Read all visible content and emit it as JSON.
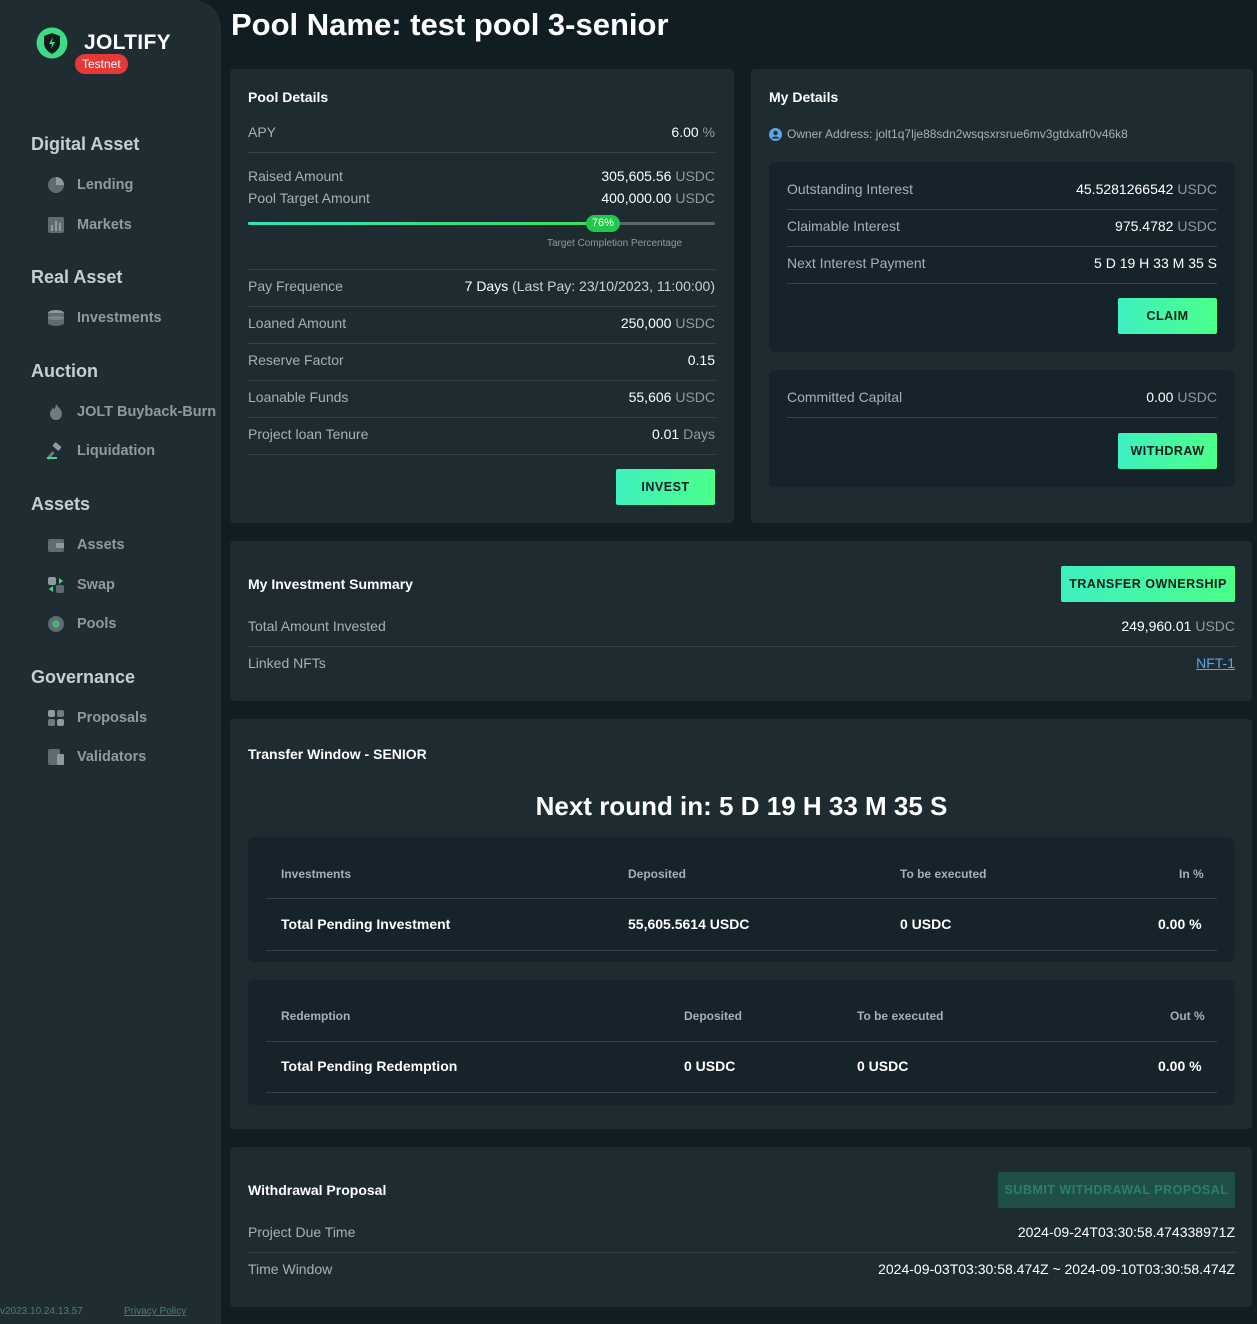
{
  "sidebar": {
    "brand": "JOLTIFY",
    "badge": "Testnet",
    "sections": [
      {
        "title": "Digital Asset",
        "items": [
          {
            "label": "Lending",
            "icon": "lending-icon"
          },
          {
            "label": "Markets",
            "icon": "markets-icon"
          }
        ]
      },
      {
        "title": "Real Asset",
        "items": [
          {
            "label": "Investments",
            "icon": "investments-icon"
          }
        ]
      },
      {
        "title": "Auction",
        "items": [
          {
            "label": "JOLT Buyback-Burn",
            "icon": "fire-icon"
          },
          {
            "label": "Liquidation",
            "icon": "gavel-icon"
          }
        ]
      },
      {
        "title": "Assets",
        "items": [
          {
            "label": "Assets",
            "icon": "wallet-icon"
          },
          {
            "label": "Swap",
            "icon": "swap-icon"
          },
          {
            "label": "Pools",
            "icon": "pools-icon"
          }
        ]
      },
      {
        "title": "Governance",
        "items": [
          {
            "label": "Proposals",
            "icon": "proposals-icon"
          },
          {
            "label": "Validators",
            "icon": "validators-icon"
          }
        ]
      }
    ],
    "version": "v2023.10.24.13.57",
    "privacy": "Privacy Policy"
  },
  "page": {
    "title": "Pool Name: test pool 3-senior"
  },
  "pool_details": {
    "title": "Pool Details",
    "apy_label": "APY",
    "apy_value": "6.00",
    "apy_unit": "%",
    "raised_label": "Raised Amount",
    "raised_value": "305,605.56",
    "raised_unit": "USDC",
    "target_label": "Pool Target Amount",
    "target_value": "400,000.00",
    "target_unit": "USDC",
    "progress_percent": 76,
    "progress_badge": "76%",
    "progress_caption": "Target Completion Percentage",
    "pay_freq_label": "Pay Frequence",
    "pay_freq_value": "7 Days",
    "pay_freq_note": "(Last Pay: 23/10/2023, 11:00:00)",
    "loaned_label": "Loaned Amount",
    "loaned_value": "250,000",
    "loaned_unit": "USDC",
    "reserve_label": "Reserve Factor",
    "reserve_value": "0.15",
    "loanable_label": "Loanable Funds",
    "loanable_value": "55,606",
    "loanable_unit": "USDC",
    "tenure_label": "Project loan Tenure",
    "tenure_value": "0.01",
    "tenure_unit": "Days",
    "invest_button": "INVEST"
  },
  "my_details": {
    "title": "My Details",
    "owner_address": "Owner Address: jolt1q7lje88sdn2wsqsxrsrue6mv3gtdxafr0v46k8",
    "outstanding_label": "Outstanding Interest",
    "outstanding_value": "45.5281266542",
    "outstanding_unit": "USDC",
    "claimable_label": "Claimable Interest",
    "claimable_value": "975.4782",
    "claimable_unit": "USDC",
    "next_payment_label": "Next Interest Payment",
    "next_payment_value": "5 D 19 H 33 M 35 S",
    "claim_button": "CLAIM",
    "committed_label": "Committed Capital",
    "committed_value": "0.00",
    "committed_unit": "USDC",
    "withdraw_button": "WITHDRAW"
  },
  "summary": {
    "title": "My Investment Summary",
    "transfer_button": "TRANSFER OWNERSHIP",
    "total_label": "Total Amount Invested",
    "total_value": "249,960.01",
    "total_unit": "USDC",
    "nfts_label": "Linked NFTs",
    "nfts_value": "NFT-1"
  },
  "transfer_window": {
    "title": "Transfer Window - SENIOR",
    "countdown": "Next round in: 5 D 19 H 33 M 35 S",
    "investments_table": {
      "headers": [
        "Investments",
        "Deposited",
        "To be executed",
        "In %"
      ],
      "row": [
        "Total Pending Investment",
        "55,605.5614 USDC",
        "0 USDC",
        "0.00 %"
      ]
    },
    "redemption_table": {
      "headers": [
        "Redemption",
        "Deposited",
        "To be executed",
        "Out %"
      ],
      "row": [
        "Total Pending Redemption",
        "0 USDC",
        "0 USDC",
        "0.00 %"
      ]
    }
  },
  "withdrawal": {
    "title": "Withdrawal Proposal",
    "submit_button": "SUBMIT WITHDRAWAL PROPOSAL",
    "due_label": "Project Due Time",
    "due_value": "2024-09-24T03:30:58.474338971Z",
    "window_label": "Time Window",
    "window_value": "2024-09-03T03:30:58.474Z ~ 2024-09-10T03:30:58.474Z"
  },
  "colors": {
    "accent": "#3df0c0",
    "accent2": "#4bff8a",
    "background": "#101d22",
    "card": "#1e2b31",
    "badge_red": "#e53935"
  }
}
